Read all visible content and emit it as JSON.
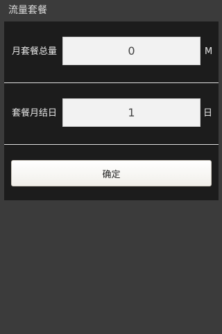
{
  "header": {
    "title": "流量套餐"
  },
  "form": {
    "monthly_total": {
      "label": "月套餐总量",
      "value": "0",
      "unit": "M"
    },
    "billing_day": {
      "label": "套餐月结日",
      "value": "1",
      "unit": "日"
    },
    "confirm_label": "确定"
  },
  "colors": {
    "background": "#3b3b3b",
    "panel": "#1c1c1c",
    "field": "#f2f2f2",
    "button": "#f7f6f2"
  }
}
